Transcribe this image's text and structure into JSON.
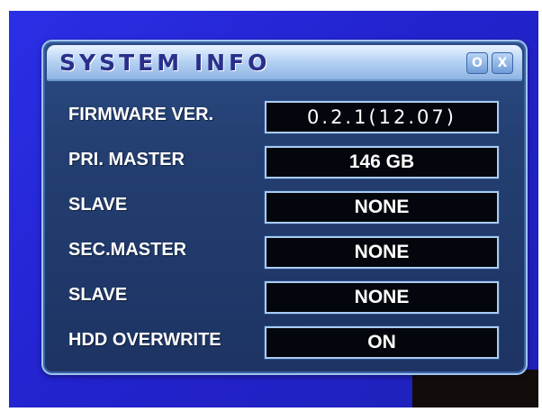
{
  "dialog": {
    "title": "SYSTEM INFO",
    "option_button": "O",
    "close_button": "X"
  },
  "rows": [
    {
      "label": "FIRMWARE VER.",
      "value": "0.2.1(12.07)"
    },
    {
      "label": "PRI. MASTER",
      "value": "146 GB"
    },
    {
      "label": "SLAVE",
      "value": "NONE"
    },
    {
      "label": "SEC.MASTER",
      "value": "NONE"
    },
    {
      "label": "SLAVE",
      "value": "NONE"
    },
    {
      "label": "HDD OVERWRITE",
      "value": "ON"
    }
  ],
  "colors": {
    "screen_background": "#2323cf",
    "dialog_background": "#243f72",
    "value_background": "#04060d",
    "title_text": "#2a2f8a"
  }
}
